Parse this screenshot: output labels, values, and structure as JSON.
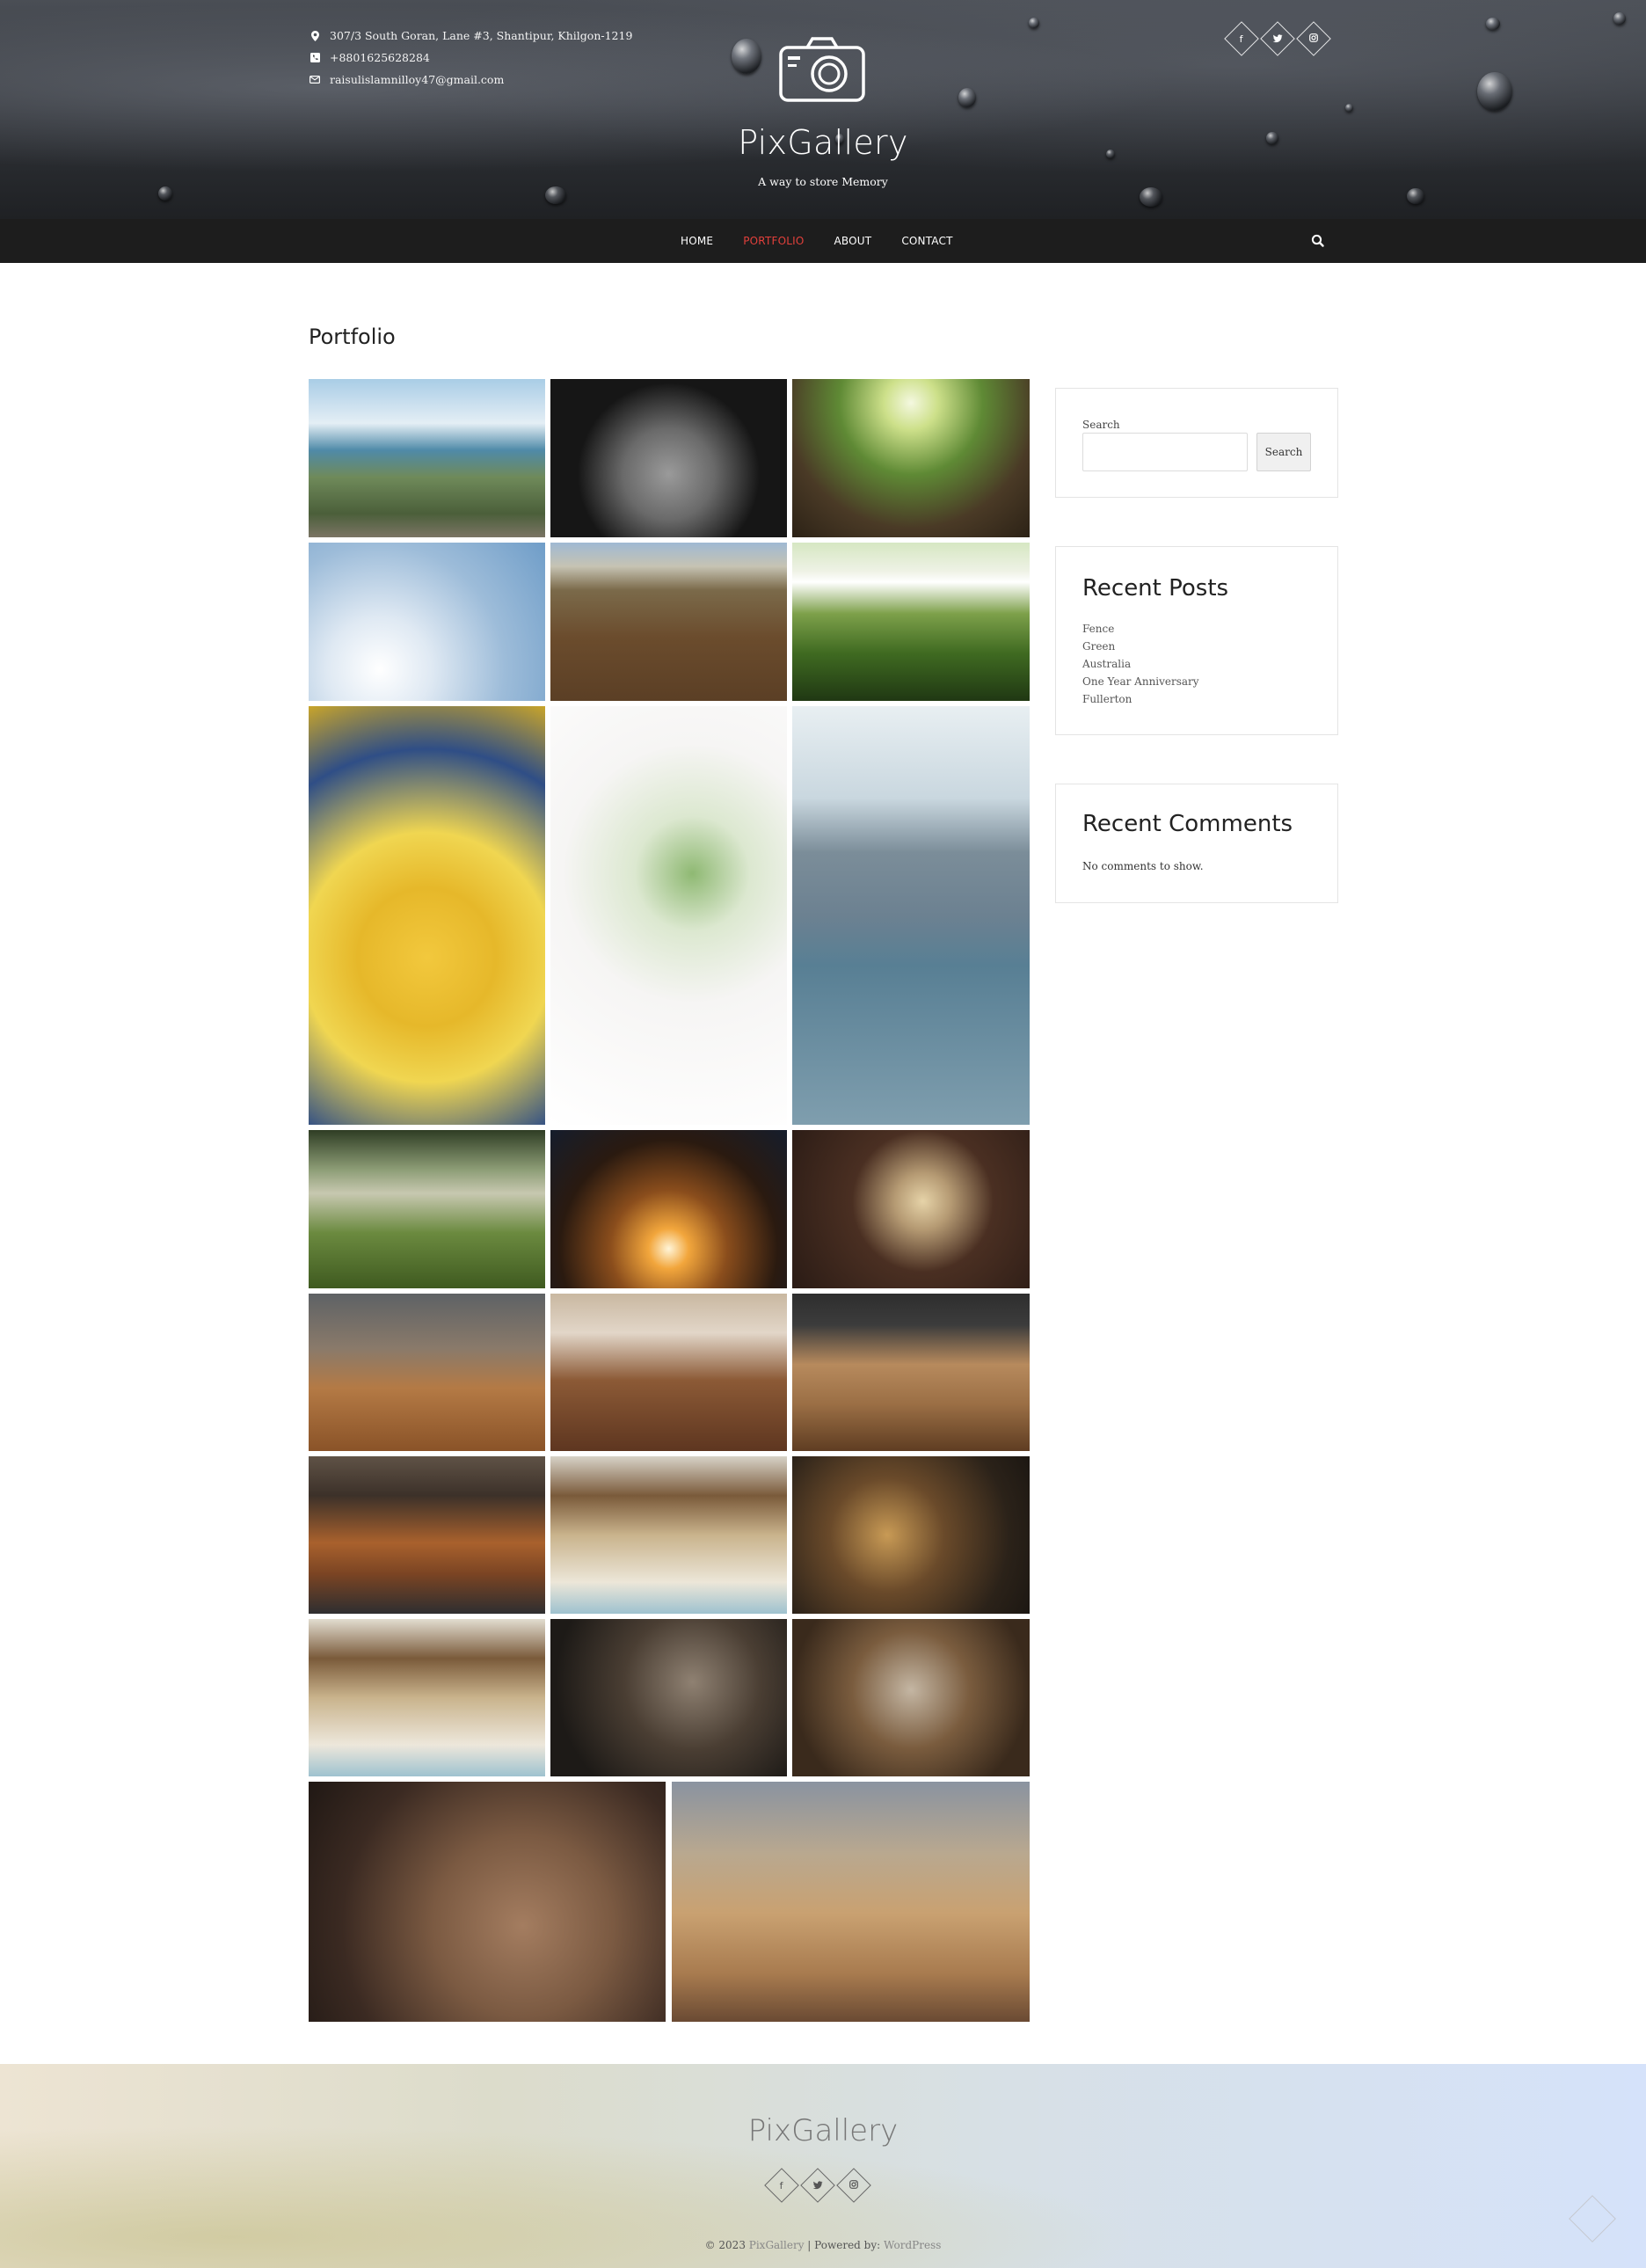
{
  "header": {
    "contact": {
      "address": "307/3 South Goran, Lane #3, Shantipur, Khilgon-1219",
      "phone": "+8801625628284",
      "email": "raisulislamnilloy47@gmail.com"
    },
    "site_title": "PixGallery",
    "tagline": "A way to store Memory",
    "social": [
      {
        "icon": "facebook-icon",
        "glyph": "f"
      },
      {
        "icon": "twitter-icon",
        "glyph": "🐦"
      },
      {
        "icon": "instagram-icon",
        "glyph": "◎"
      }
    ]
  },
  "nav": {
    "items": [
      "HOME",
      "PORTFOLIO",
      "ABOUT",
      "CONTACT"
    ],
    "active": "PORTFOLIO",
    "search_icon": "search-icon"
  },
  "main": {
    "heading": "Portfolio",
    "gallery": [
      {
        "name": "city-harbour-bridge",
        "bg": "linear-gradient(180deg,#a9cde6 0%,#e4eef5 28%,#4f8aa8 45%,#6f8a5a 62%,#4b5f3a 85%,#7a7464 100%)"
      },
      {
        "name": "opera-house-lattice",
        "bg": "radial-gradient(circle at 50% 60%,#9a9a9a 0%,#6a6a6a 30%,#161616 60%),repeating-linear-gradient(45deg,#1a1a1a 0 14px,#888 14px 60px)"
      },
      {
        "name": "tree-trunk-upward",
        "bg": "radial-gradient(circle at 50% 15%,#f4f8e0 0%,#cde08a 15%,#5f8a35 40%,#4a3a26 70%,#2c2216 100%)"
      },
      {
        "name": "water-tower-sky",
        "bg": "radial-gradient(circle at 30% 80%,#ffffff 0%,#dfe9f3 25%,#9dbcd9 60%,#6f9dc8 100%)"
      },
      {
        "name": "balloon-over-vineyard",
        "bg": "linear-gradient(180deg,#9fb9d3 0%,#c6c3b3 15%,#7b6a4a 30%,#6b4c2d 60%,#5b3f25 100%)"
      },
      {
        "name": "garden-fence-toy",
        "bg": "linear-gradient(180deg,#d6e7c2 0%,#eef2e5 18%,#ffffff 25%,#7da04a 45%,#3f6a21 70%,#203813 100%)"
      },
      {
        "name": "yellow-balloon-canopy",
        "bg": "radial-gradient(circle at 50% 60%,#f2c83d 0%,#e6b82a 25%,#f0d651 45%,#2f4e86 75%,#c9a52a 100%)"
      },
      {
        "name": "green-leaves-white",
        "bg": "radial-gradient(circle at 60% 40%,#8fb973 0%,#dce8d0 20%,#f6f5f4 45%,#ffffff 100%)"
      },
      {
        "name": "skyline-harbour-boats",
        "bg": "linear-gradient(180deg,#e8eff2 0%,#c9d7df 22%,#7b8d99 35%,#6c8191 50%,#587f94 62%,#7f9eae 100%)"
      },
      {
        "name": "valley-hills",
        "bg": "linear-gradient(180deg,#2f3d24 0%,#8d9d76 25%,#c7c8b0 40%,#6b8a3f 65%,#3f5a20 100%)"
      },
      {
        "name": "campfire-night",
        "bg": "radial-gradient(circle at 50% 75%,#fff5d8 0%,#f2a63c 12%,#8a4d1c 35%,#2a1a10 65%,#151d2c 100%)"
      },
      {
        "name": "crackers-on-table",
        "bg": "radial-gradient(circle at 55% 45%,#e6d3a8 0%,#b59a73 18%,#4a2f22 45%,#2a1b15 100%)"
      },
      {
        "name": "plant-on-desk",
        "bg": "linear-gradient(180deg,#5e6265 0%,#8a7a6a 35%,#b47a45 60%,#8a5328 100%)"
      },
      {
        "name": "cafe-table-cup",
        "bg": "linear-gradient(180deg,#c9b8a1 0%,#e2d6c8 25%,#8c5a36 55%,#5e3620 100%)"
      },
      {
        "name": "workbench-chair",
        "bg": "linear-gradient(180deg,#2e2e2e 0%,#3c3c3c 20%,#b78a5d 45%,#9b6f45 70%,#5f3d22 100%)"
      },
      {
        "name": "dining-lamps",
        "bg": "linear-gradient(180deg,#5f5246 0%,#3c3129 25%,#a9612d 55%,#7a4423 75%,#2e2e30 100%)"
      },
      {
        "name": "tool-wall-chisels",
        "bg": "linear-gradient(180deg,#d7d2c7 0%,#7a5a3a 25%,#c9b38c 50%,#ece6d8 80%,#9ec2cf 100%)"
      },
      {
        "name": "rustic-workshop",
        "bg": "radial-gradient(circle at 40% 50%,#c89a55 0%,#6a4a2a 35%,#2b2219 75%,#1c1712 100%)"
      },
      {
        "name": "tool-wall-closeup",
        "bg": "linear-gradient(180deg,#e2ddd0 0%,#7a5a3a 25%,#c9b38c 50%,#ede7db 80%,#9ec2cf 100%)"
      },
      {
        "name": "carving-bench-dark",
        "bg": "radial-gradient(circle at 60% 40%,#8f8172 0%,#4a3e33 40%,#1d1a17 80%)"
      },
      {
        "name": "carving-bench-light",
        "bg": "radial-gradient(circle at 50% 45%,#c4b6a3 0%,#7a5c3e 40%,#3a2a1c 80%)"
      },
      {
        "name": "woodworker-sanding",
        "bg": "radial-gradient(circle at 60% 60%,#a47d60 0%,#7b5a42 35%,#3b2a22 70%,#201814 100%)"
      },
      {
        "name": "workshop-spray-cans",
        "bg": "linear-gradient(180deg,#8a93a0 0%,#b9a88f 30%,#c9a171 55%,#a87b4f 80%,#6a4a33 100%)"
      }
    ]
  },
  "sidebar": {
    "search_label": "Search",
    "search_button": "Search",
    "search_value": "",
    "recent_posts_title": "Recent Posts",
    "recent_posts": [
      "Fence",
      "Green",
      "Australia",
      "One Year Anniversary",
      "Fullerton"
    ],
    "recent_comments_title": "Recent Comments",
    "no_comments": "No comments to show."
  },
  "footer": {
    "title": "PixGallery",
    "copyright_prefix": "© 2023 ",
    "copyright_site": "PixGallery",
    "copyright_mid": " | Powered by: ",
    "copyright_powered": "WordPress"
  },
  "colors": {
    "accent": "#e2403b",
    "nav_bg": "#1d1d1d"
  }
}
